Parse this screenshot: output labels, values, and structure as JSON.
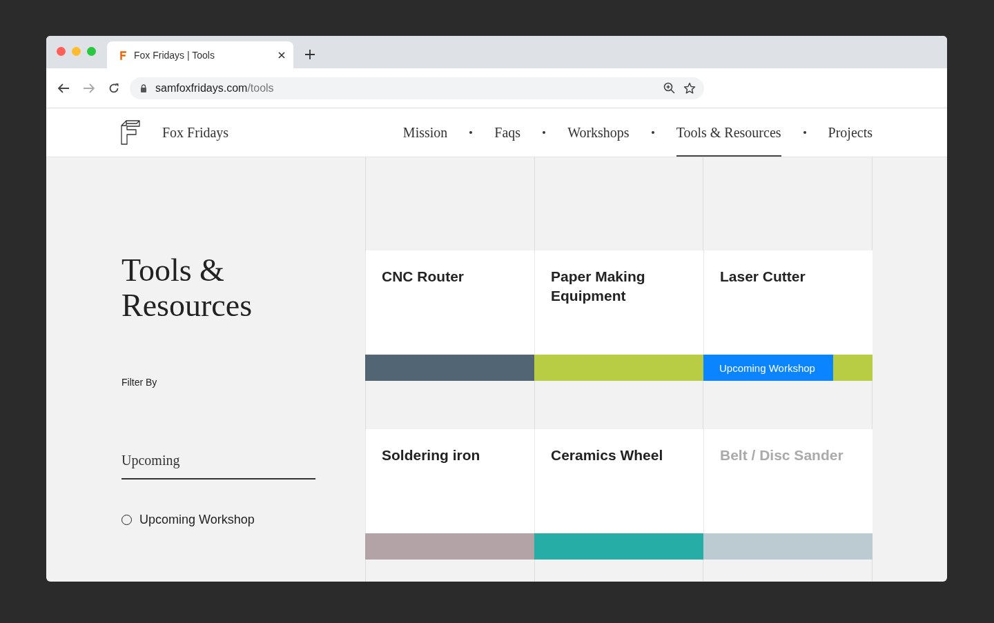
{
  "browser": {
    "tab": {
      "title": "Fox Fridays | Tools"
    },
    "url": {
      "host": "samfoxfridays.com",
      "path": "/tools"
    }
  },
  "site": {
    "name": "Fox Fridays",
    "nav": [
      {
        "label": "Mission",
        "selected": false
      },
      {
        "label": "Faqs",
        "selected": false
      },
      {
        "label": "Workshops",
        "selected": false
      },
      {
        "label": "Tools & Resources",
        "selected": true
      },
      {
        "label": "Projects",
        "selected": false
      }
    ]
  },
  "sidebar": {
    "title": "Tools & Resources",
    "filter_label": "Filter By",
    "filter_group": "Upcoming",
    "options": [
      {
        "label": "Upcoming Workshop",
        "checked": false
      }
    ]
  },
  "tools": [
    {
      "name": "CNC Router",
      "color": "#526575",
      "disabled": false
    },
    {
      "name": "Paper Making Equipment",
      "color": "#b8cc44",
      "disabled": false
    },
    {
      "name": "Laser Cutter",
      "color": "#b8cc44",
      "disabled": false,
      "badge": "Upcoming Workshop"
    },
    {
      "name": "Soldering iron",
      "color": "#b3a3a6",
      "disabled": false
    },
    {
      "name": "Ceramics Wheel",
      "color": "#26aea6",
      "disabled": false
    },
    {
      "name": "Belt / Disc Sander",
      "color": "#bccad2",
      "disabled": true
    }
  ]
}
